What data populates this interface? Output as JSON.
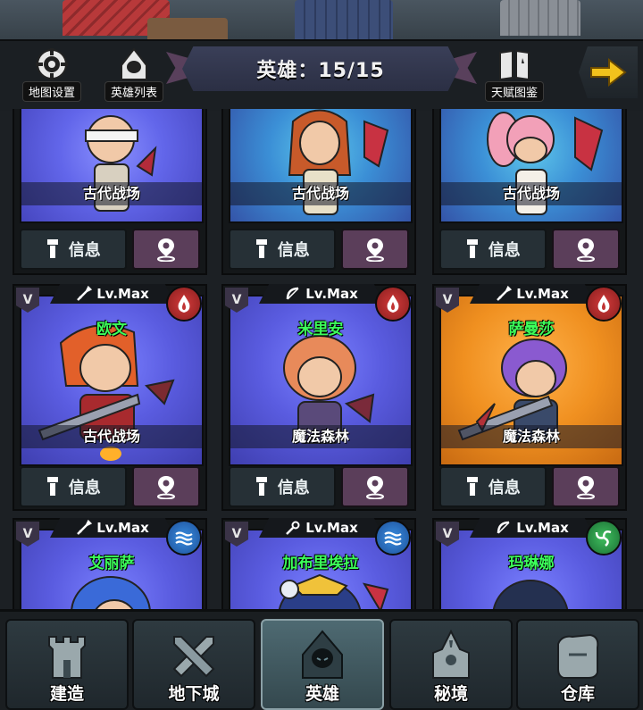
{
  "header": {
    "title": "英雄：15/15",
    "map_settings_label": "地图设置",
    "hero_list_label": "英雄列表",
    "talent_guide_label": "天赋图鉴"
  },
  "cards_top": [
    {
      "region": "古代战场",
      "info_label": "信息",
      "bg": "bg-indigo"
    },
    {
      "region": "古代战场",
      "info_label": "信息",
      "bg": "bg-cyan"
    },
    {
      "region": "古代战场",
      "info_label": "信息",
      "bg": "bg-cyan"
    }
  ],
  "cards_mid": [
    {
      "name": "欧文",
      "level": "Lv.Max",
      "rank": "V",
      "region": "古代战场",
      "info_label": "信息",
      "element": "fire-icon",
      "weapon": "sword-icon",
      "bg": "bg-blue"
    },
    {
      "name": "米里安",
      "level": "Lv.Max",
      "rank": "V",
      "region": "魔法森林",
      "info_label": "信息",
      "element": "fire-icon",
      "weapon": "bow-icon",
      "bg": "bg-blue"
    },
    {
      "name": "萨曼莎",
      "level": "Lv.Max",
      "rank": "V",
      "region": "魔法森林",
      "info_label": "信息",
      "element": "fire-icon",
      "weapon": "sword-icon",
      "bg": "bg-orange"
    }
  ],
  "cards_bottom": [
    {
      "name": "艾丽萨",
      "level": "Lv.Max",
      "rank": "V",
      "element": "water-icon",
      "weapon": "sword-icon",
      "bg": "bg-blue"
    },
    {
      "name": "加布里埃拉",
      "level": "Lv.Max",
      "rank": "V",
      "element": "water-icon",
      "weapon": "staff-icon",
      "bg": "bg-blue"
    },
    {
      "name": "玛琳娜",
      "level": "Lv.Max",
      "rank": "V",
      "element": "wind-icon",
      "weapon": "bow-icon",
      "bg": "bg-blue"
    }
  ],
  "bottom_nav": [
    {
      "label": "建造",
      "icon": "castle-icon",
      "active": false
    },
    {
      "label": "地下城",
      "icon": "crossed-swords-icon",
      "active": false
    },
    {
      "label": "英雄",
      "icon": "hooded-hero-icon",
      "active": true
    },
    {
      "label": "秘境",
      "icon": "secret-realm-icon",
      "active": false
    },
    {
      "label": "仓库",
      "icon": "warehouse-icon",
      "active": false
    }
  ],
  "colors": {
    "hero_name": "#3cff5a",
    "fire": "#d13a3a",
    "water": "#3a8fe0",
    "wind": "#3fbf5e",
    "back_arrow": "#f2c21c"
  }
}
